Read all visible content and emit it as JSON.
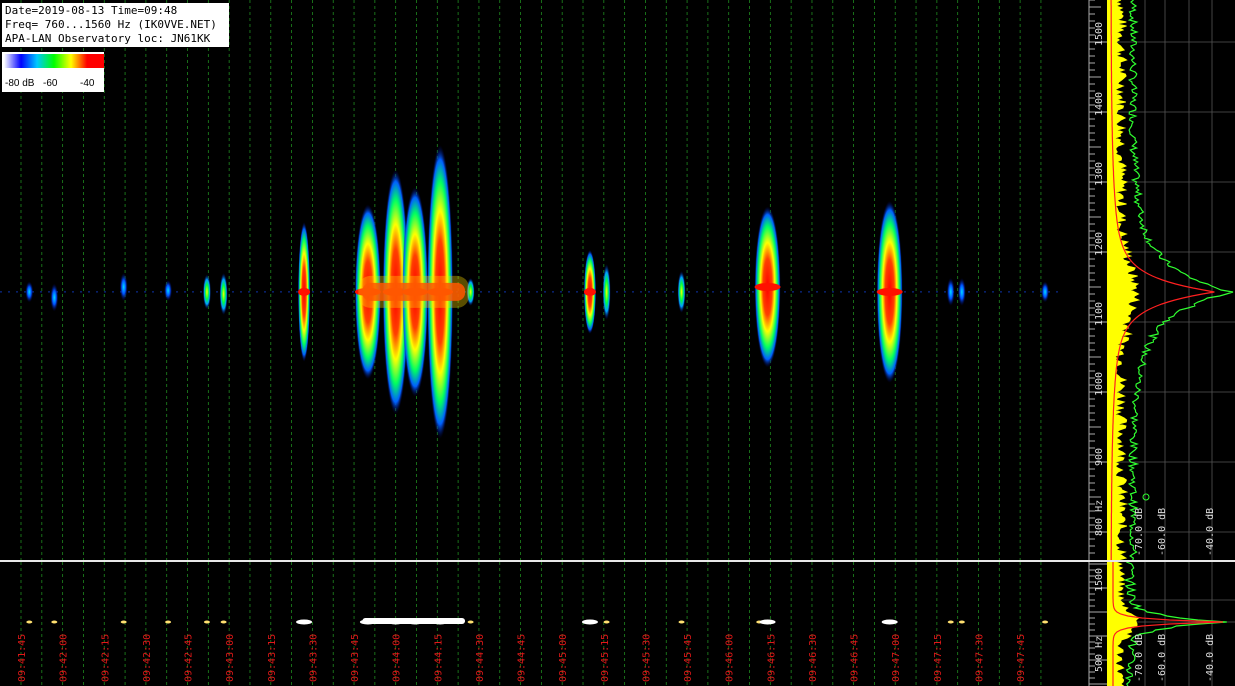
{
  "info": {
    "line1": "Date=2019-08-13 Time=09:48",
    "line2": "Freq= 760...1560 Hz (IK0VVE.NET)",
    "line3": "APA-LAN Observatory loc: JN61KK"
  },
  "legend": {
    "labels": [
      "-80 dB",
      "-60",
      "-40"
    ],
    "colors": [
      "#ffffff",
      "#0000ff",
      "#00c8ff",
      "#00ff00",
      "#ffff00",
      "#ff0000",
      "#ff0000"
    ]
  },
  "time_labels": [
    "09:41:45",
    "09:42:00",
    "09:42:15",
    "09:42:30",
    "09:42:45",
    "09:43:00",
    "09:43:15",
    "09:43:30",
    "09:43:45",
    "09:44:00",
    "09:44:15",
    "09:44:30",
    "09:44:45",
    "09:45:00",
    "09:45:15",
    "09:45:30",
    "09:45:45",
    "09:46:00",
    "09:46:15",
    "09:46:30",
    "09:46:45",
    "09:47:00",
    "09:47:15",
    "09:47:30",
    "09:47:45"
  ],
  "freq_labels": [
    "1500",
    "1400",
    "1300",
    "1200",
    "1100",
    "1000",
    "900",
    "800 Hz"
  ],
  "bottom_freq_labels": [
    "1500",
    "500 Hz"
  ],
  "db_labels": [
    "-70.0 dB",
    "-60.0 dB",
    "-40.0 dB"
  ],
  "bottom_db_labels": [
    "-70.0 dB",
    "-60.0 dB",
    "-40.0 dB"
  ],
  "chart_data": {
    "type": "heatmap",
    "title": "",
    "x_axis": "time",
    "y_axis": "frequency (Hz)",
    "y_range": [
      760,
      1560
    ],
    "carrier_hz": 1143,
    "events": [
      {
        "time": "09:41:48",
        "freq_center": 1143,
        "intensity": -62,
        "extent_hz": 30
      },
      {
        "time": "09:41:57",
        "freq_center": 1135,
        "intensity": -66,
        "extent_hz": 40
      },
      {
        "time": "09:42:22",
        "freq_center": 1150,
        "intensity": -65,
        "extent_hz": 40
      },
      {
        "time": "09:42:38",
        "freq_center": 1145,
        "intensity": -66,
        "extent_hz": 30
      },
      {
        "time": "09:42:52",
        "freq_center": 1143,
        "intensity": -52,
        "extent_hz": 50
      },
      {
        "time": "09:42:58",
        "freq_center": 1140,
        "intensity": -55,
        "extent_hz": 60
      },
      {
        "time": "09:43:27",
        "freq_center": 1143,
        "intensity": -45,
        "extent_hz": 200
      },
      {
        "time": "09:43:50",
        "freq_center": 1143,
        "intensity": -38,
        "extent_hz": 250
      },
      {
        "time": "09:44:00",
        "freq_center": 1143,
        "intensity": -40,
        "extent_hz": 350
      },
      {
        "time": "09:44:07",
        "freq_center": 1143,
        "intensity": -40,
        "extent_hz": 300
      },
      {
        "time": "09:44:16",
        "freq_center": 1143,
        "intensity": -38,
        "extent_hz": 420
      },
      {
        "time": "09:44:27",
        "freq_center": 1143,
        "intensity": -52,
        "extent_hz": 40
      },
      {
        "time": "09:45:10",
        "freq_center": 1143,
        "intensity": -45,
        "extent_hz": 120
      },
      {
        "time": "09:45:16",
        "freq_center": 1143,
        "intensity": -48,
        "extent_hz": 80
      },
      {
        "time": "09:45:43",
        "freq_center": 1143,
        "intensity": -52,
        "extent_hz": 60
      },
      {
        "time": "09:46:11",
        "freq_center": 1143,
        "intensity": -50,
        "extent_hz": 60
      },
      {
        "time": "09:46:14",
        "freq_center": 1150,
        "intensity": -42,
        "extent_hz": 230
      },
      {
        "time": "09:46:58",
        "freq_center": 1143,
        "intensity": -40,
        "extent_hz": 260
      },
      {
        "time": "09:47:20",
        "freq_center": 1143,
        "intensity": -56,
        "extent_hz": 40
      },
      {
        "time": "09:47:24",
        "freq_center": 1143,
        "intensity": -56,
        "extent_hz": 40
      },
      {
        "time": "09:47:54",
        "freq_center": 1143,
        "intensity": -64,
        "extent_hz": 30
      }
    ]
  }
}
